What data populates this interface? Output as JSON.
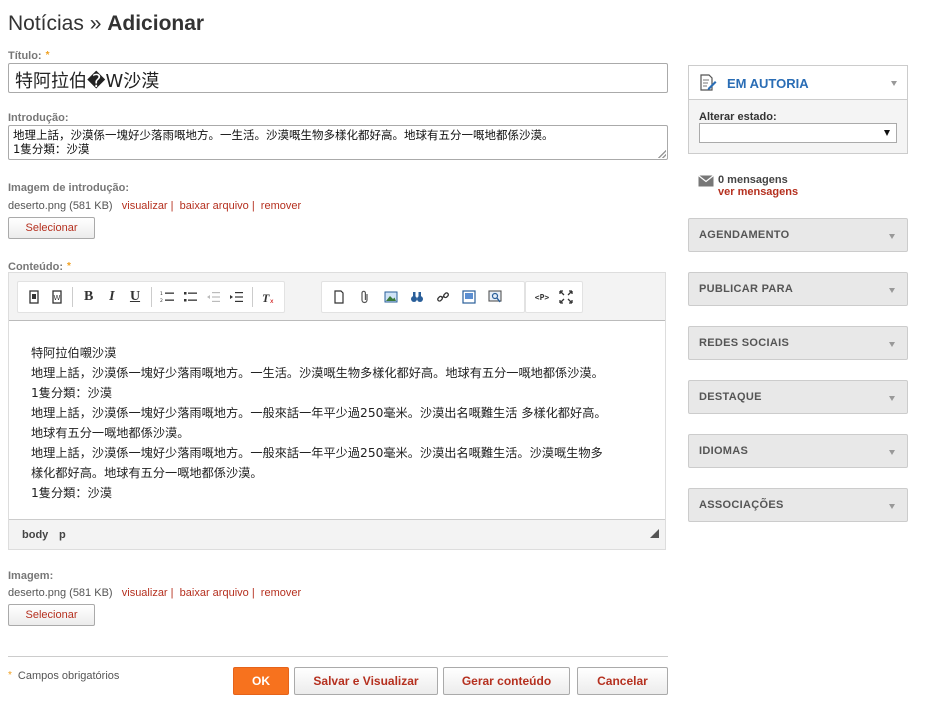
{
  "header": {
    "section": "Notícias",
    "separator": "»",
    "action": "Adicionar"
  },
  "required_mark": "*",
  "form": {
    "title_label": "Título:",
    "title_value": "特阿拉伯�W沙漠",
    "intro_label": "Introdução:",
    "intro_lines": [
      "地理上話，沙漠係一塊好少落雨嘅地方。一生活。沙漠嘅生物多樣化都好高。地球有五分一嘅地都係沙漠。",
      "1隻分類：沙漠"
    ],
    "intro_image": {
      "label": "Imagem de introdução:",
      "file": "deserto.png (581 KB)",
      "view": "visualizar",
      "download": "baixar arquivo",
      "remove": "remover",
      "sep": "|",
      "select_button": "Selecionar"
    },
    "content_label": "Conteúdo:",
    "content_lines": [
      "特阿拉伯嚫沙漠",
      "地理上話，沙漠係一塊好少落雨嘅地方。一生活。沙漠嘅生物多樣化都好高。地球有五分一嘅地都係沙漠。",
      "1隻分類：沙漠",
      "地理上話，沙漠係一塊好少落雨嘅地方。一般來話一年平少過250毫米。沙漠出名嘅難生活 多樣化都好高。",
      "地球有五分一嘅地都係沙漠。",
      "地理上話，沙漠係一塊好少落雨嘅地方。一般來話一年平少過250毫米。沙漠出名嘅難生活。沙漠嘅生物多",
      "樣化都好高。地球有五分一嘅地都係沙漠。",
      "1隻分類：沙漠"
    ],
    "editor_path": [
      "body",
      "p"
    ],
    "image": {
      "label": "Imagem:",
      "file": "deserto.png (581 KB)",
      "view": "visualizar",
      "download": "baixar arquivo",
      "remove": "remover",
      "sep": "|",
      "select_button": "Selecionar"
    }
  },
  "toolbar": {
    "bold": "B",
    "italic": "I",
    "underline": "U",
    "source": "<P>"
  },
  "footer": {
    "required_note": "Campos obrigatórios",
    "ok": "OK",
    "save_preview": "Salvar e Visualizar",
    "generate": "Gerar conteúdo",
    "cancel": "Cancelar"
  },
  "sidebar": {
    "status_title": "EM AUTORIA",
    "change_status_label": "Alterar estado:",
    "messages_count": "0 mensagens",
    "messages_link": "ver mensagens",
    "panels": [
      "AGENDAMENTO",
      "PUBLICAR PARA",
      "REDES SOCIAIS",
      "DESTAQUE",
      "IDIOMAS",
      "ASSOCIAÇÕES"
    ]
  },
  "colors": {
    "accent_link": "#b5301f",
    "ok_button": "#f7721e",
    "status_title": "#2a6db5",
    "required_mark": "#f0a020"
  }
}
